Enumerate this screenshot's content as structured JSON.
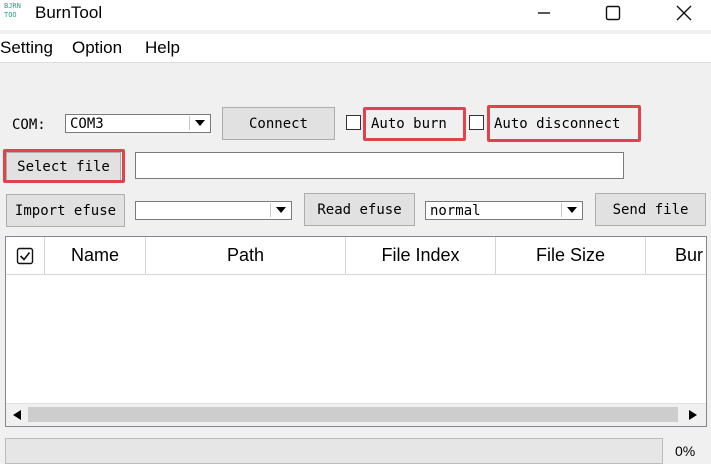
{
  "app": {
    "icon_text": [
      "BJRN",
      "TOO"
    ],
    "title": "BurnTool",
    "window_controls": [
      "minimize-icon",
      "maximize-icon",
      "close-icon"
    ]
  },
  "menu": [
    "Setting",
    "Option",
    "Help"
  ],
  "row1": {
    "com_label": "COM:",
    "com_value": "COM3",
    "connect_label": "Connect",
    "auto_burn_label": "Auto burn",
    "auto_burn_checked": false,
    "auto_disconnect_label": "Auto disconnect",
    "auto_disconnect_checked": false
  },
  "row2": {
    "select_file_label": "Select file",
    "file_path": ""
  },
  "row3": {
    "import_efuse_label": "Import efuse",
    "efuse_value": "",
    "read_efuse_label": "Read efuse",
    "mode_value": "normal",
    "send_file_label": "Send file"
  },
  "table": {
    "columns": [
      "Name",
      "Path",
      "File Index",
      "File Size",
      "Bur"
    ],
    "rows": []
  },
  "progress": {
    "percent_label": "0%",
    "value": 0
  },
  "colors": {
    "highlight": "#e0434b",
    "icon": "#2a9d8f"
  }
}
